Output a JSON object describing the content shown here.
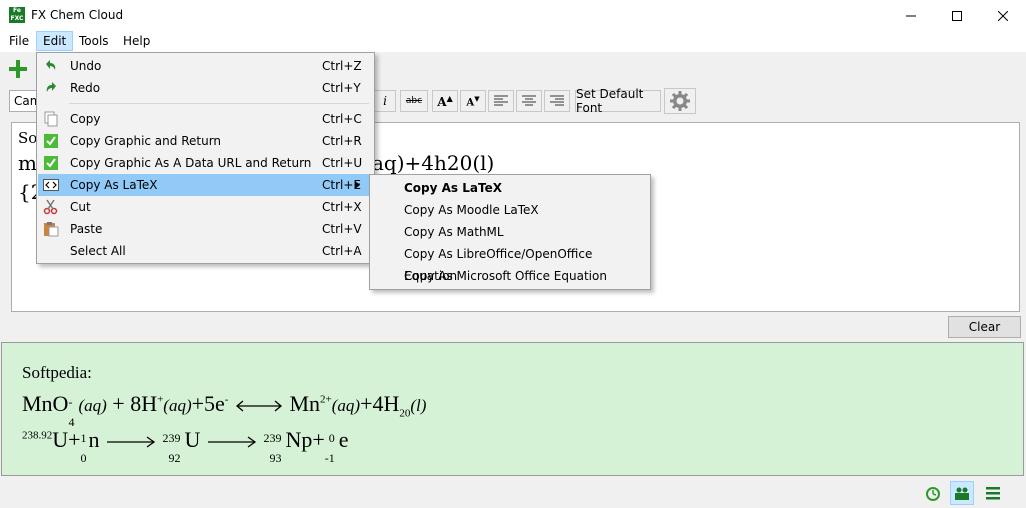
{
  "app": {
    "title": "FX Chem Cloud"
  },
  "menubar": {
    "items": [
      {
        "label": "File"
      },
      {
        "label": "Edit"
      },
      {
        "label": "Tools"
      },
      {
        "label": "Help"
      }
    ]
  },
  "toolbar": {
    "font_value": "Cam",
    "default_font_label": "Set Default Font"
  },
  "editor": {
    "line1": "Sof",
    "line2_start": "m",
    "line2_end": "aq)+4h20(l)",
    "line3": "{2"
  },
  "clear_label": "Clear",
  "edit_menu": {
    "items": [
      {
        "label": "Undo",
        "shortcut": "Ctrl+Z"
      },
      {
        "label": "Redo",
        "shortcut": "Ctrl+Y"
      },
      {
        "label": "Copy",
        "shortcut": "Ctrl+C"
      },
      {
        "label": "Copy Graphic and Return",
        "shortcut": "Ctrl+R"
      },
      {
        "label": "Copy Graphic As A Data URL and Return",
        "shortcut": "Ctrl+U"
      },
      {
        "label": "Copy As LaTeX",
        "shortcut": "Ctrl+E"
      },
      {
        "label": "Cut",
        "shortcut": "Ctrl+X"
      },
      {
        "label": "Paste",
        "shortcut": "Ctrl+V"
      },
      {
        "label": "Select All",
        "shortcut": "Ctrl+A"
      }
    ]
  },
  "submenu": {
    "items": [
      {
        "label": "Copy As LaTeX"
      },
      {
        "label": "Copy As Moodle LaTeX"
      },
      {
        "label": "Copy As MathML"
      },
      {
        "label": "Copy As LibreOffice/OpenOffice Equation"
      },
      {
        "label": "Copy As Microsoft Office Equation"
      }
    ]
  },
  "preview": {
    "label": "Softpedia:",
    "eq1": {
      "mno": "MnO",
      "mno_sub": "4",
      "mno_sup": "-",
      "aq1": "(aq)",
      "plus8h": " + 8H",
      "h_sup": "+",
      "aq2": "(aq)",
      "plus5e": "+5e",
      "e_sup": "-",
      "mn": "Mn",
      "mn_sup": "2+",
      "aq3": "(aq)",
      "plus4h": "+4H",
      "h_sub": "20",
      "l": "(l)"
    },
    "eq2": {
      "u_sup": "238.92",
      "u": "U+",
      "n_sup": "1",
      "n_sub": "0",
      "n": "n",
      "u2_sup": "239",
      "u2_sub": "92",
      "u2": "U",
      "np_sup": "239",
      "np_sub": "93",
      "np": "Np+",
      "e_sup": "0",
      "e_sub": "-1",
      "e": "e"
    }
  },
  "colors": {
    "preview_bg": "#d5f2d7",
    "menu_highlight": "#91c9f7",
    "active_menu": "#cce8ff",
    "green_icon": "#2b9a2b"
  }
}
